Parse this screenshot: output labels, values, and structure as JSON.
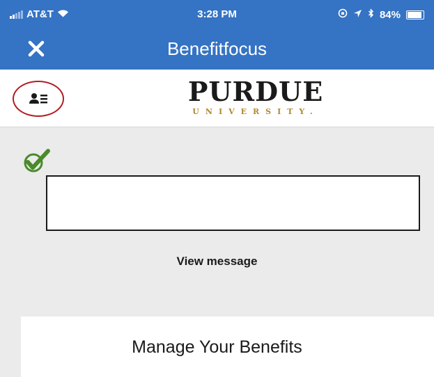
{
  "status_bar": {
    "carrier": "AT&T",
    "time": "3:28 PM",
    "battery": "84%"
  },
  "app_bar": {
    "title": "Benefitfocus",
    "close_icon": "close-icon"
  },
  "header": {
    "logo_main": "PURDUE",
    "logo_sub": "UNIVERSITY.",
    "profile_icon": "profile-card-icon",
    "highlight_color": "#b01e24"
  },
  "alert": {
    "check_icon": "checkmark-icon",
    "check_color": "#4a8a2a",
    "view_message_label": "View message"
  },
  "card": {
    "title": "Manage Your Benefits"
  },
  "colors": {
    "app_bar": "#3573c4",
    "content_bg": "#ebebeb",
    "logo_gold": "#b08a2e"
  }
}
